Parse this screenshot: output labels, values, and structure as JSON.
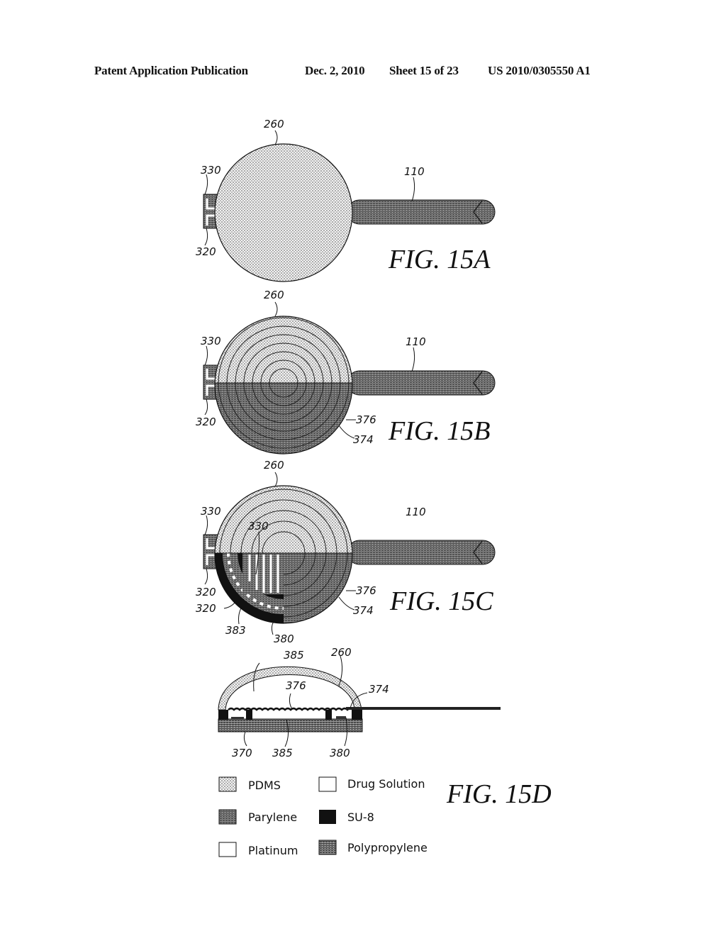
{
  "header": {
    "publication": "Patent Application Publication",
    "date": "Dec. 2, 2010",
    "sheet": "Sheet 15 of 23",
    "number": "US 2010/0305550 A1"
  },
  "figures": {
    "fig15a": {
      "caption": "FIG. 15A",
      "labels": {
        "pdms_circle": "260",
        "electrode_top": "330",
        "electrode_bottom": "320",
        "cannula": "110"
      }
    },
    "fig15b": {
      "caption": "FIG. 15B",
      "labels": {
        "pdms_circle": "260",
        "electrode_top": "330",
        "electrode_bottom": "320",
        "cannula": "110",
        "corrugation": "376",
        "membrane": "374"
      }
    },
    "fig15c": {
      "caption": "FIG. 15C",
      "labels": {
        "pdms_circle": "260",
        "electrode_top": "330",
        "electrode_inner": "330",
        "electrode_bottom": "320",
        "electrode_lower": "320",
        "ring": "383",
        "su8": "380",
        "cannula": "110",
        "corrugation": "376",
        "membrane": "374"
      }
    },
    "fig15d": {
      "caption": "FIG. 15D",
      "labels": {
        "chamber_top": "385",
        "dome": "260",
        "corrugation": "376",
        "membrane": "374",
        "base": "370",
        "chamber_bottom": "385",
        "su8": "380"
      }
    }
  },
  "legend": [
    {
      "key": "pdms",
      "label": "PDMS"
    },
    {
      "key": "drug",
      "label": "Drug Solution"
    },
    {
      "key": "parylene",
      "label": "Parylene"
    },
    {
      "key": "su8",
      "label": "SU-8"
    },
    {
      "key": "platinum",
      "label": "Platinum"
    },
    {
      "key": "polypropylene",
      "label": "Polypropylene"
    }
  ]
}
